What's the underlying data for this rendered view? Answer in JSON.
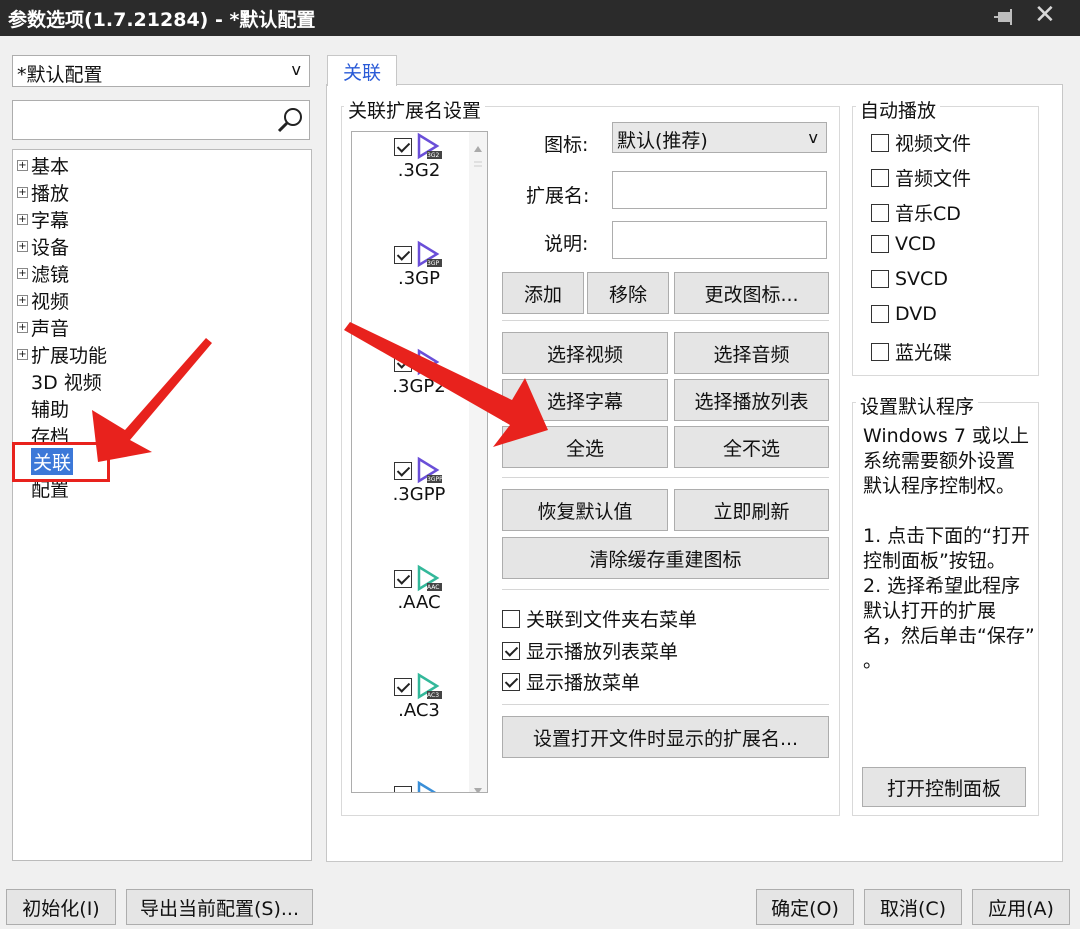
{
  "window": {
    "title": "参数选项(1.7.21284) - *默认配置"
  },
  "sidebar": {
    "profile": "*默认配置",
    "profile_arrow": "v",
    "search_value": "",
    "tree": [
      {
        "label": "基本",
        "expander": "+"
      },
      {
        "label": "播放",
        "expander": "+"
      },
      {
        "label": "字幕",
        "expander": "+"
      },
      {
        "label": "设备",
        "expander": "+"
      },
      {
        "label": "滤镜",
        "expander": "+"
      },
      {
        "label": "视频",
        "expander": "+"
      },
      {
        "label": "声音",
        "expander": "+"
      },
      {
        "label": "扩展功能",
        "expander": "+"
      },
      {
        "label": "3D 视频",
        "expander": ""
      },
      {
        "label": "辅助",
        "expander": ""
      },
      {
        "label": "存档",
        "expander": ""
      },
      {
        "label": "关联",
        "expander": "",
        "selected": true
      },
      {
        "label": "配置",
        "expander": ""
      }
    ]
  },
  "tab": {
    "label": "关联"
  },
  "assoc": {
    "group_title": "关联扩展名设置",
    "extensions": [
      {
        "badge": "3G2",
        "name": ".3G2",
        "checked": true,
        "color": "#6a4fd8"
      },
      {
        "badge": "3GP",
        "name": ".3GP",
        "checked": true,
        "color": "#6a4fd8"
      },
      {
        "badge": "3GP2",
        "name": ".3GP2",
        "checked": true,
        "color": "#6a4fd8"
      },
      {
        "badge": "3GPP",
        "name": ".3GPP",
        "checked": true,
        "color": "#6a4fd8"
      },
      {
        "badge": "AAC",
        "name": ".AAC",
        "checked": true,
        "color": "#33b89a"
      },
      {
        "badge": "AC3",
        "name": ".AC3",
        "checked": true,
        "color": "#33b89a"
      }
    ],
    "icon_label": "图标:",
    "icon_value": "默认(推荐)",
    "icon_arrow": "v",
    "ext_label": "扩展名:",
    "ext_value": "",
    "desc_label": "说明:",
    "desc_value": "",
    "buttons": {
      "add": "添加",
      "remove": "移除",
      "change_icon": "更改图标...",
      "select_video": "选择视频",
      "select_audio": "选择音频",
      "select_subtitle": "选择字幕",
      "select_playlist": "选择播放列表",
      "select_all": "全选",
      "select_none": "全不选",
      "restore_default": "恢复默认值",
      "refresh_now": "立即刷新",
      "clear_cache": "清除缓存重建图标",
      "set_open_ext": "设置打开文件时显示的扩展名..."
    },
    "options": [
      {
        "label": "关联到文件夹右菜单",
        "checked": false
      },
      {
        "label": "显示播放列表菜单",
        "checked": true
      },
      {
        "label": "显示播放菜单",
        "checked": true
      }
    ]
  },
  "autoplay": {
    "title": "自动播放",
    "items": [
      {
        "label": "视频文件",
        "checked": false
      },
      {
        "label": "音频文件",
        "checked": false
      },
      {
        "label": "音乐CD",
        "checked": false
      },
      {
        "label": "VCD",
        "checked": false
      },
      {
        "label": "SVCD",
        "checked": false
      },
      {
        "label": "DVD",
        "checked": false
      },
      {
        "label": "蓝光碟",
        "checked": false
      }
    ]
  },
  "default_program": {
    "title": "设置默认程序",
    "description": "Windows 7 或以上\n系统需要额外设置\n默认程序控制权。\n\n1. 点击下面的“打开\n控制面板”按钮。\n2. 选择希望此程序\n默认打开的扩展\n名，然后单击“保存”\n。",
    "button": "打开控制面板"
  },
  "footer": {
    "init": "初始化(I)",
    "export": "导出当前配置(S)...",
    "ok": "确定(O)",
    "cancel": "取消(C)",
    "apply": "应用(A)"
  },
  "annotation_color": "#e8221d"
}
